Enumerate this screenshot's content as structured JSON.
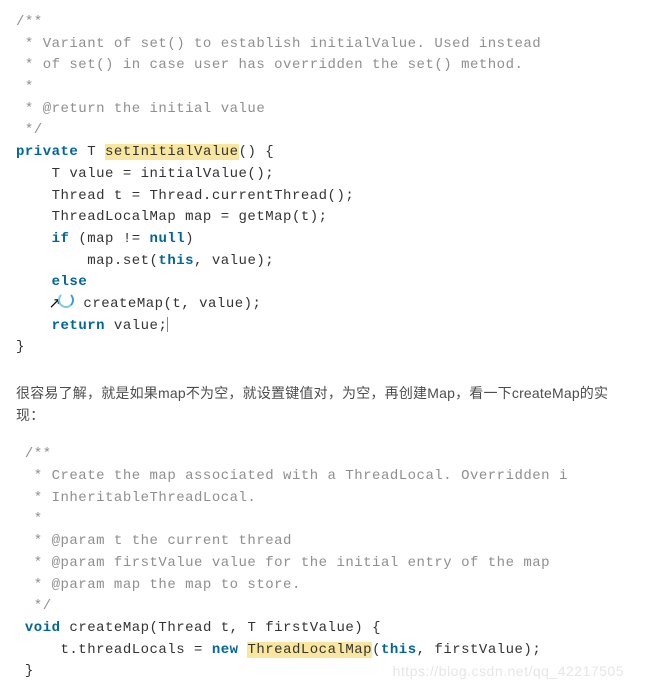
{
  "block1": {
    "c1": "/**",
    "c2": " * Variant of set() to establish initialValue. Used instead",
    "c3": " * of set() in case user has overridden the set() method.",
    "c4": " *",
    "c5": " * @return the initial value",
    "c6": " */",
    "kw_private": "private",
    "type_T": " T ",
    "fn_name": "setInitialValue",
    "after_name": "() {",
    "l1": "    T value = initialValue();",
    "l2": "    Thread t = Thread.currentThread();",
    "l3": "    ThreadLocalMap map = getMap(t);",
    "kw_if": "if",
    "if_cond_open": " (map != ",
    "kw_null": "null",
    "if_cond_close": ")",
    "l5": "        map.set(",
    "kw_this1": "this",
    "l5b": ", value);",
    "kw_else": "else",
    "l7": "  createMap(t, value);",
    "kw_return": "return",
    "l8": " value;",
    "close": "}"
  },
  "prose_text": "很容易了解，就是如果map不为空，就设置键值对，为空，再创建Map，看一下createMap的实现：",
  "block2": {
    "c1": " /**",
    "c2": "  * Create the map associated with a ThreadLocal. Overridden i",
    "c3": "  * InheritableThreadLocal.",
    "c4": "  *",
    "c5": "  * @param t the current thread",
    "c6": "  * @param firstValue value for the initial entry of the map",
    "c7": "  * @param map the map to store.",
    "c8": "  */",
    "kw_void": "void",
    "sig_rest": " createMap(Thread t, T firstValue) {",
    "body_a": "     t.threadLocals = ",
    "kw_new": "new",
    "sp": " ",
    "hl_tlm": "ThreadLocalMap",
    "paren": "(",
    "kw_this2": "this",
    "body_b": ", firstValue);",
    "close": " }"
  },
  "watermark": "https://blog.csdn.net/qq_42217505"
}
